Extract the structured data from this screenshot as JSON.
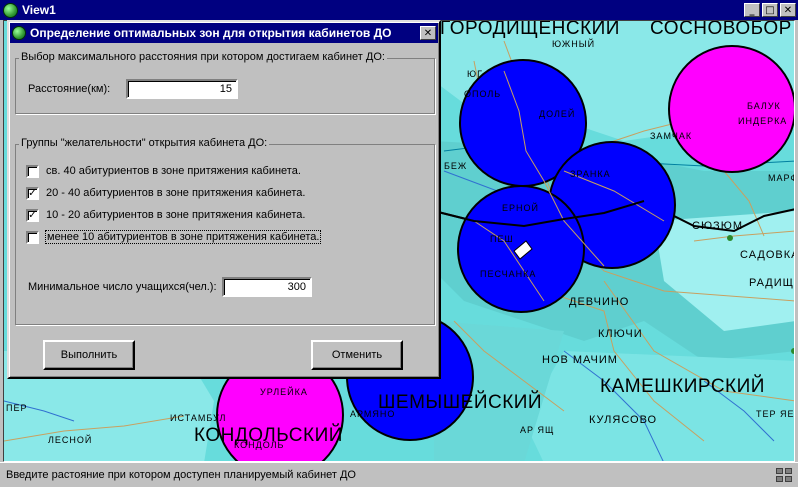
{
  "app": {
    "title": "View1",
    "minimize": "_",
    "maximize": "□",
    "close": "✕"
  },
  "map": {
    "labels": {
      "gorodishchensky": "ГОРОДИЩЕНСКИЙ",
      "sosnovobor": "СОСНОВОБОР",
      "yuzhny": "ЮЖНЫЙ",
      "yug": "ЮГ",
      "lopol": "ОПОЛЬ",
      "chamzino": "ДОЛЕЙ",
      "zamyak": "ЗАМЧАК",
      "baluk": "БАЛУК",
      "inderka": "ИНДЕРКА",
      "marf": "МАРФ",
      "bezh": "БЕЖ",
      "uranka": "ЗРАНКА",
      "ernoy": "ЕРНОЙ",
      "syuzyum": "СЮЗЮМ",
      "sadovka": "САДОВКА",
      "radishch": "РАДИЩЕ",
      "pesh": "ПЕШ",
      "peschanka": "ПЕСЧАНКА",
      "devchino": "ДЕВЧИНО",
      "klyuchi": "КЛЮЧИ",
      "nov_machim": "НОВ МАЧИМ",
      "kameshkirsky": "КАМЕШКИРСКИЙ",
      "shemysheysky": "ШЕМЫШЕЙСКИЙ",
      "urleyka": "УРЛЕЙКА",
      "kulyasovo": "КУЛЯСОВО",
      "ter_yes": "ТЕР ЯЕ",
      "per": "ПЕР",
      "stambul": "ИСТАМБУЛ",
      "armyanino": "АРМЯНО",
      "ar_yashch": "АР ЯЩ",
      "lesnoy": "ЛЕСНОЙ",
      "kondolsky": "КОНДОЛЬСКИЙ",
      "kondol": "КОНДОЛЬ"
    }
  },
  "dialog": {
    "title": "Определение оптимальных зон для открытия кабинетов ДО",
    "close": "✕",
    "distance_group": {
      "legend": "Выбор максимального расстояния при котором  достигаем кабинет ДО:",
      "label": "Расстояние(км):",
      "value": "15"
    },
    "groups_group": {
      "legend": "Группы \"желательности\"  открытия кабинета ДО:",
      "options": [
        {
          "label": "св. 40 абитуриентов в зоне притяжения кабинета.",
          "mark": ""
        },
        {
          "label": "20 - 40 абитуриентов в зоне притяжения кабинета.",
          "mark": "✓"
        },
        {
          "label": "10 - 20 абитуриентов в зоне притяжения кабинета.",
          "mark": "✓"
        },
        {
          "label": "менее 10 абитуриентов в зоне притяжения кабинета.",
          "mark": ""
        }
      ],
      "min_label": "Минимальное число учащихся(чел.):",
      "min_value": "300"
    },
    "execute_button": "Выполнить",
    "cancel_button": "Отменить"
  },
  "status": {
    "text": "Введите растояние при котором доступен планируемый кабинет ДО"
  },
  "colors": {
    "titlebar": "#000080",
    "map_water": "#67dcdc",
    "zone_blue": "#0000ff",
    "zone_magenta": "#ff00ff",
    "window_face": "#c0c0c0"
  }
}
